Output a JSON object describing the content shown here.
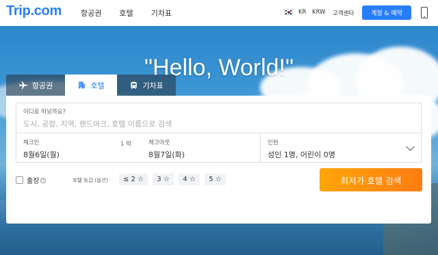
{
  "header": {
    "logo": "Trip.com",
    "nav": [
      "항공권",
      "호텔",
      "기차표"
    ],
    "language": "KR",
    "currency": "KRW",
    "support": "고객센터",
    "account_button": "계정 & 예약",
    "icons": [
      "korea-flag-icon",
      "phone-icon"
    ]
  },
  "hero": {
    "headline": "\"Hello, World!\""
  },
  "tabs": [
    {
      "label": "항공권",
      "icon": "airplane-icon"
    },
    {
      "label": "호텔",
      "icon": "hotel-icon",
      "active": true
    },
    {
      "label": "기차표",
      "icon": "train-icon"
    }
  ],
  "search": {
    "destination_label": "어디로 떠날까요?",
    "destination_placeholder": "도시, 공항, 지역, 랜드마크, 호텔 이름으로 검색",
    "checkin_label": "체크인",
    "checkin_value": "8월6일(월)",
    "nights": "1 박",
    "checkout_label": "체크아웃",
    "checkout_value": "8월7일(화)",
    "guests_label": "인원",
    "guests_value": "성인 1명, 어린이 0명",
    "business_label": "출장",
    "grade_label": "호텔 등급 (옵션)",
    "grades": [
      "≤ 2 ☆",
      "3 ☆",
      "4 ☆",
      "5 ☆"
    ],
    "submit_label": "최저가 호텔 검색"
  },
  "colors": {
    "brand": "#287dfa",
    "search_button": "#ff8c0f"
  }
}
